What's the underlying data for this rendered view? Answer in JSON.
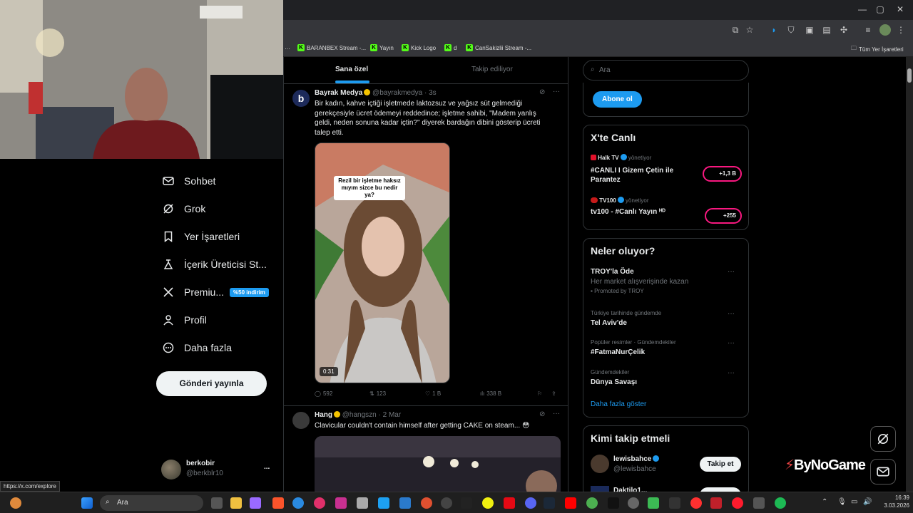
{
  "browser": {
    "bookmarks": [
      "BARANBEX Stream -...",
      "Yayın",
      "Kick Logo",
      "d",
      "CanSakizlii Stream -..."
    ],
    "all_bookmarks_label": "Tüm Yer İşaretleri",
    "status_url": "https://x.com/explore"
  },
  "nav": {
    "items": [
      {
        "label": "Sohbet",
        "icon": "mail-icon"
      },
      {
        "label": "Grok",
        "icon": "grok-icon"
      },
      {
        "label": "Yer İşaretleri",
        "icon": "bookmark-icon"
      },
      {
        "label": "İçerik Üreticisi St...",
        "icon": "creator-icon"
      },
      {
        "label": "Premiu...",
        "icon": "x-logo-icon"
      },
      {
        "label": "Profil",
        "icon": "person-icon"
      },
      {
        "label": "Daha fazla",
        "icon": "more-circle-icon"
      }
    ],
    "premium_badge": "%50 indirim",
    "post_button": "Gönderi yayınla",
    "account": {
      "name": "berkobir",
      "handle": "@berkblr10",
      "more": "..."
    }
  },
  "feed": {
    "tabs": [
      "Sana özel",
      "Takip ediliyor"
    ],
    "tweets": [
      {
        "avatar_letter": "b",
        "name": "Bayrak Medya",
        "handle": "@bayrakmedya",
        "time": "· 3s",
        "text": "Bir kadın, kahve içtiği işletmede laktozsuz ve yağsız süt gelmediği gerekçesiyle ücret ödemeyi reddedince; işletme sahibi, \"Madem yanlış geldi, neden sonuna kadar içtin?\" diyerek bardağın dibini gösterip ücreti talep etti.",
        "video_caption": "Rezil bir işletme haksız mıyım sizce bu nedir ya?",
        "duration": "0:31",
        "replies": "592",
        "reposts": "123",
        "likes": "1 B",
        "views": "338 B"
      },
      {
        "name": "Hang",
        "handle": "@hangszn",
        "time": "· 2 Mar",
        "text": "Clavicular couldn't contain himself after getting CAKE on steam... 😳"
      }
    ]
  },
  "right": {
    "search_placeholder": "Ara",
    "subscribe_button": "Abone ol",
    "live": {
      "title": "X'te Canlı",
      "items": [
        {
          "host": "Halk TV",
          "host_role": "yönetiyor",
          "title": "#CANLI I Gizem Çetin ile Parantez",
          "count": "+1,3 B"
        },
        {
          "host": "TV100",
          "host_role": "yönetiyor",
          "title": "tv100 - #Canlı Yayın ᴴᴰ",
          "count": "+255"
        }
      ]
    },
    "trends": {
      "title": "Neler oluyor?",
      "items": [
        {
          "context": "",
          "title": "TROY'la Öde",
          "sub": "Her market alışverişinde kazan",
          "promo": "Promoted by TROY"
        },
        {
          "context": "Türkiye tarihinde gündemde",
          "title": "Tel Aviv'de"
        },
        {
          "context": "Popüler resimler · Gündemdekiler",
          "title": "#FatmaNurÇelik"
        },
        {
          "context": "Gündemdekiler",
          "title": "Dünya Savaşı"
        }
      ],
      "show_more": "Daha fazla göster"
    },
    "who_to_follow": {
      "title": "Kimi takip etmeli",
      "items": [
        {
          "name": "lewisbahce",
          "handle": "@lewisbahce",
          "button": "Takip et"
        },
        {
          "name": "Daktilo1...",
          "handle": "",
          "button": ""
        }
      ]
    }
  },
  "overlay": {
    "watermark": "ByNoGame"
  },
  "taskbar": {
    "search": "Ara",
    "time": "16:39",
    "date": "3.03.2026"
  },
  "colors": {
    "accent": "#1d9bf0",
    "kick": "#53fc18",
    "live": "#f91880"
  }
}
